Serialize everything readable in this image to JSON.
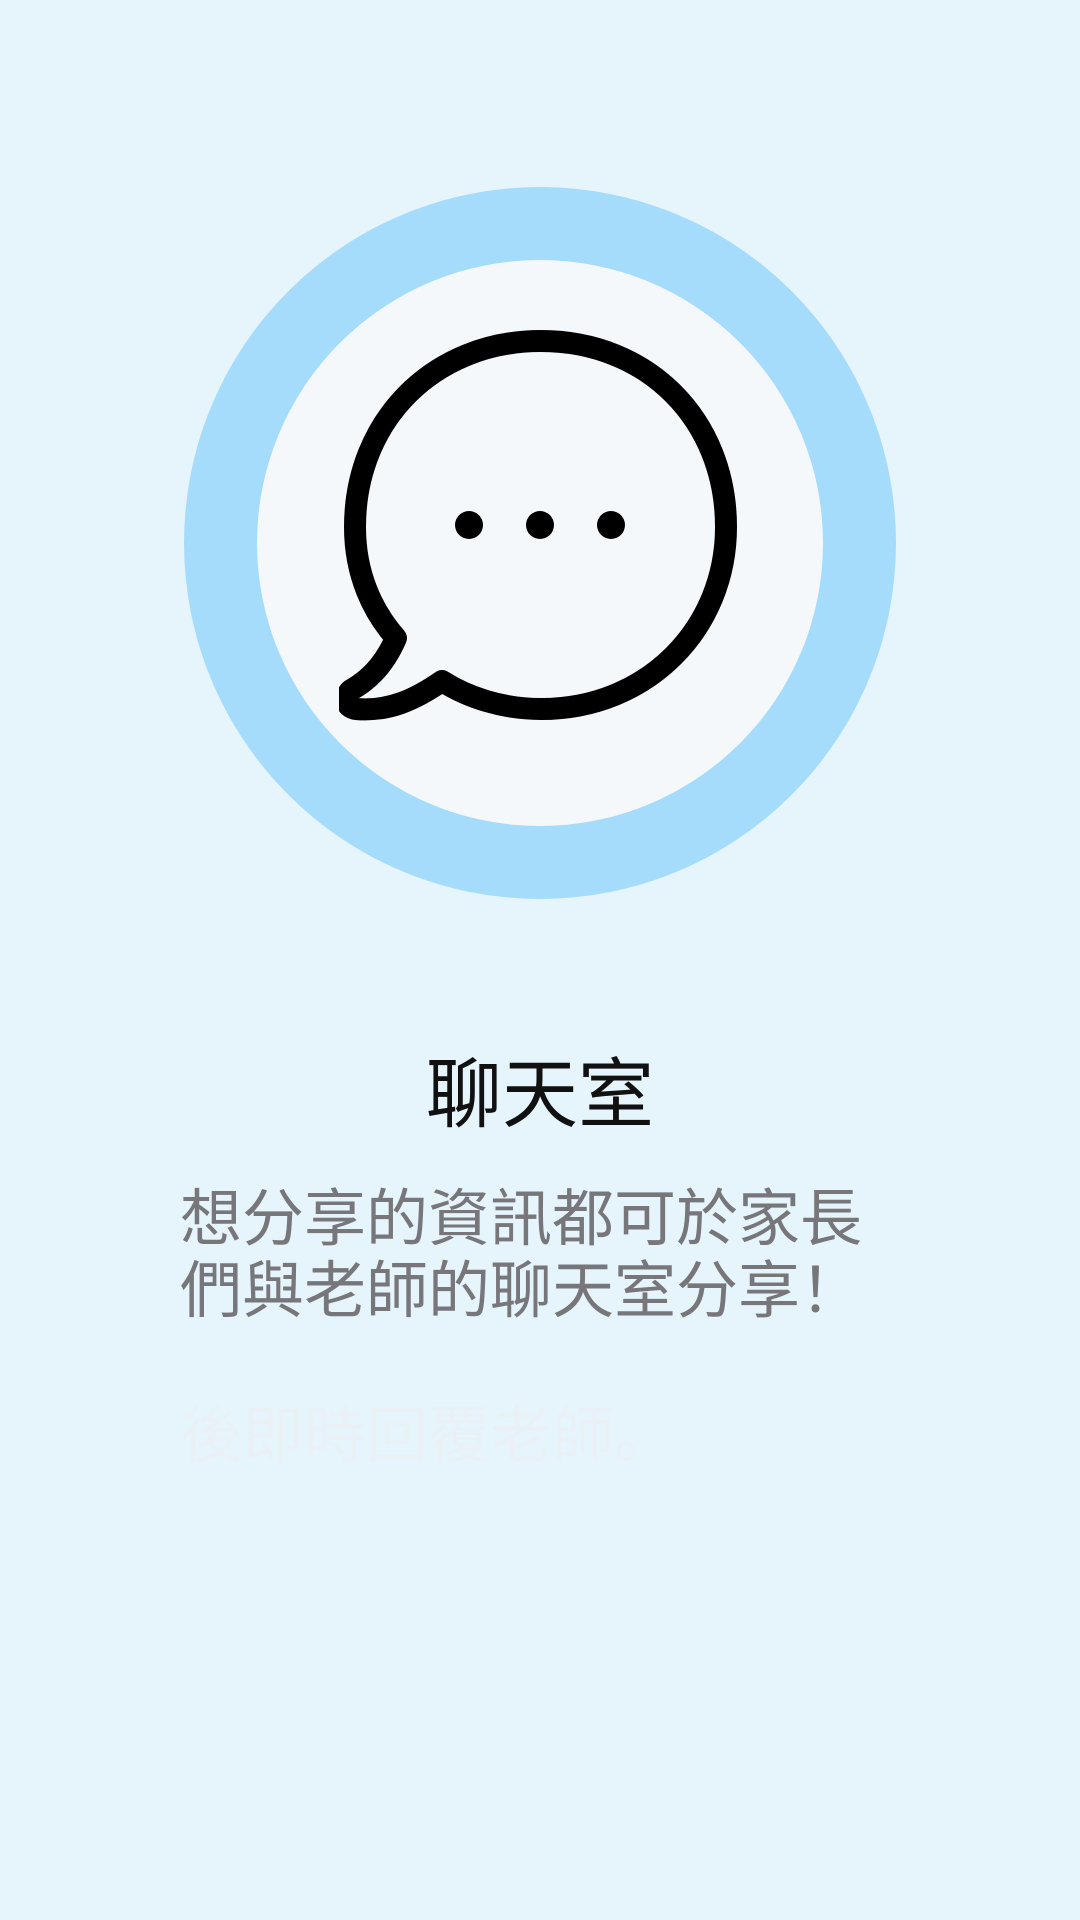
{
  "onboarding": {
    "icon": "chat-bubble-icon",
    "title": "聊天室",
    "description": "想分享的資訊都可於家長們與老師的聊天室分享！",
    "faded_text": "後即時回覆老師。",
    "colors": {
      "background": "#e6f4fc",
      "ring": "#a6dcfb",
      "inner_circle": "#f4f8fb",
      "title": "#111111",
      "description": "#77777b"
    }
  }
}
